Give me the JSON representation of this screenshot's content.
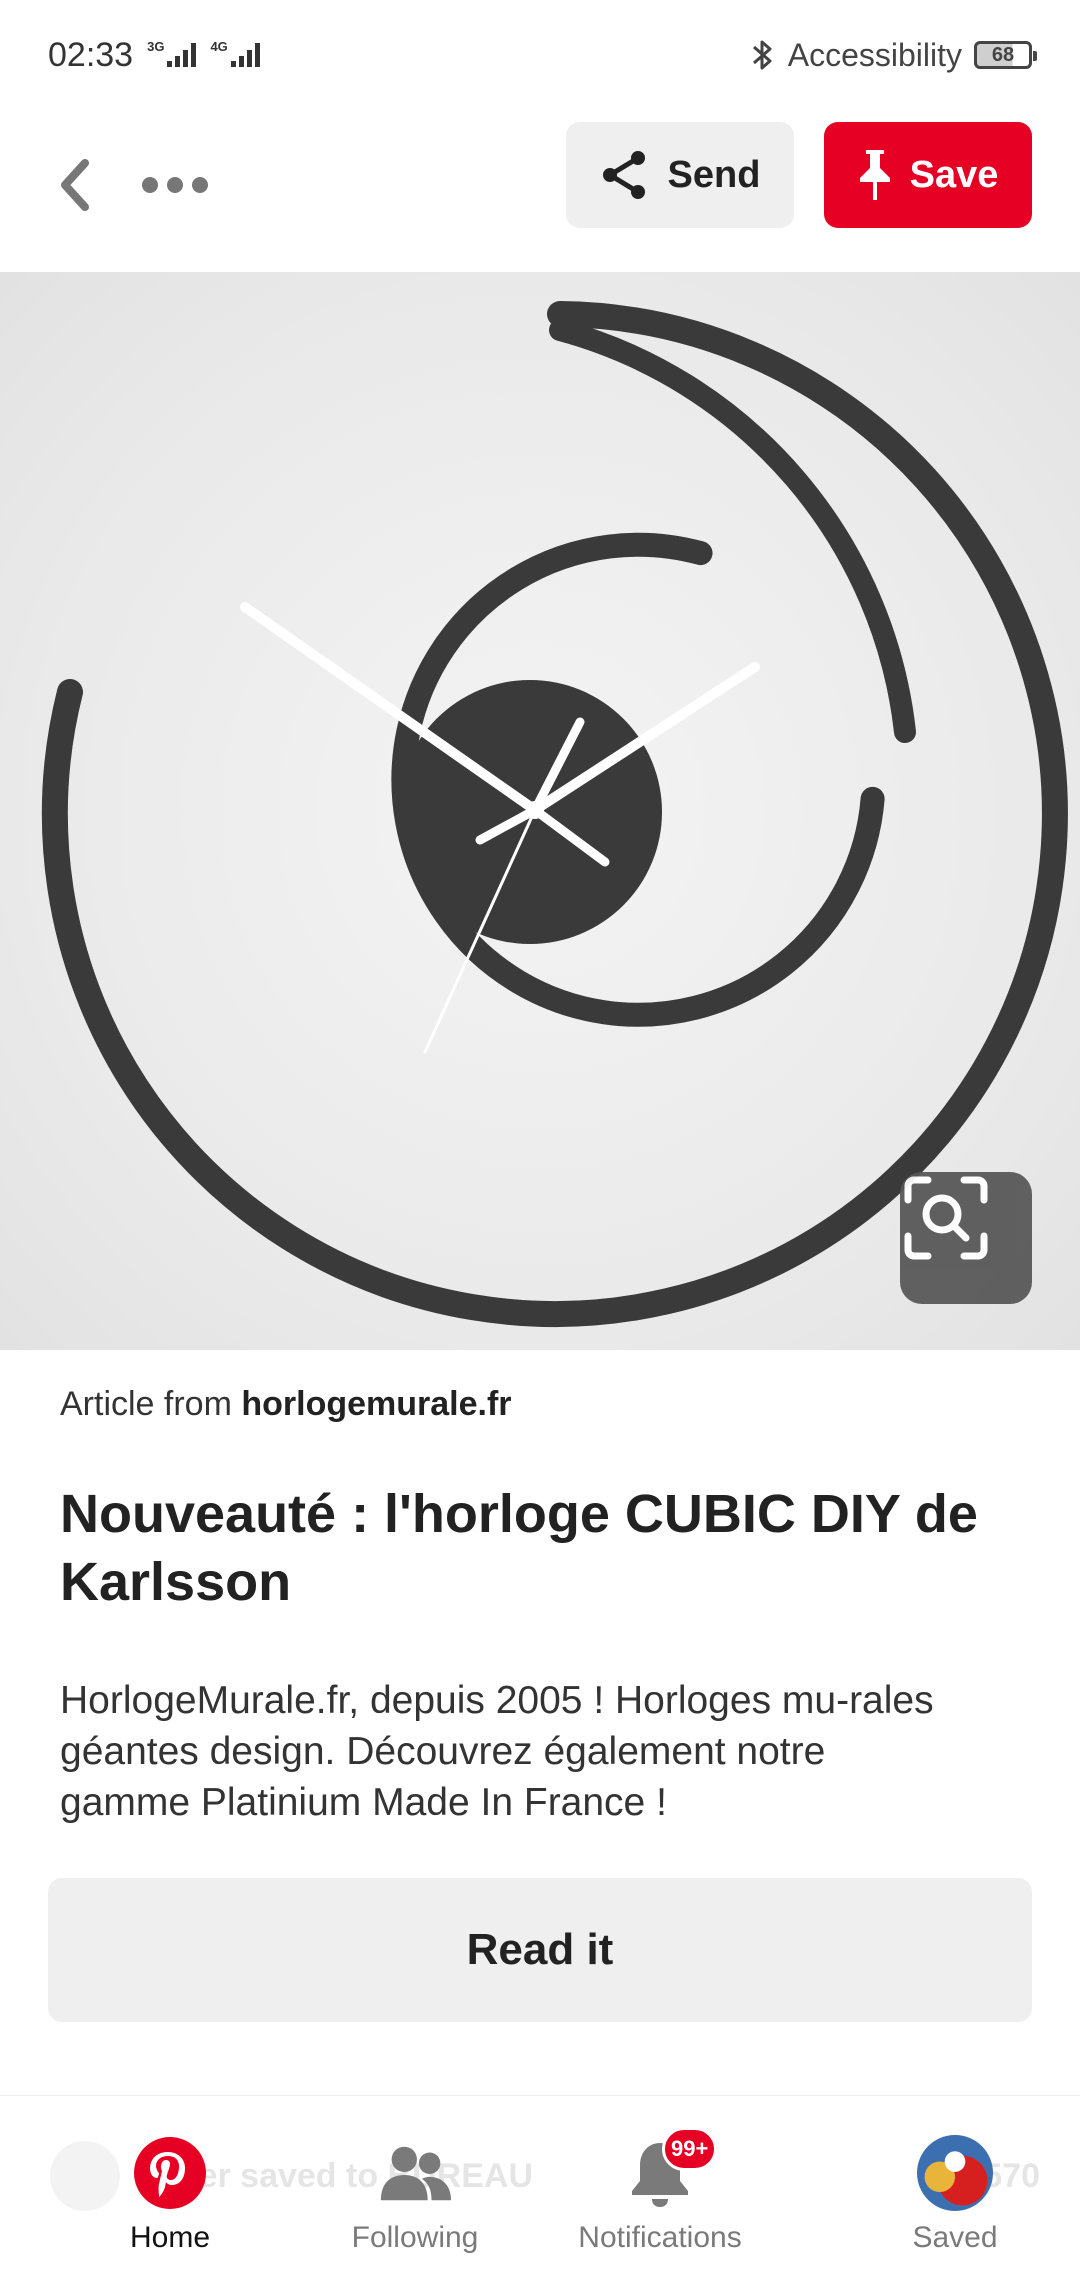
{
  "status_bar": {
    "time": "02:33",
    "net1": "3G",
    "net2": "4G",
    "accessibility": "Accessibility",
    "battery": "68"
  },
  "topbar": {
    "send_label": "Send",
    "save_label": "Save",
    "save_color": "#e60023"
  },
  "pin": {
    "source_prefix": "Article from",
    "source_domain": "horlogemurale.fr",
    "title": "Nouveauté : l'horloge CUBIC DIY de Karlsson",
    "description": "HorlogeMurale.fr, depuis 2005 ! Horloges mu-rales géantes design. Découvrez également notre gamme Platinium Made In France !",
    "read_button": "Read it"
  },
  "peek": {
    "text": "nivier saved to BUREAU",
    "count": "570"
  },
  "bottom_nav": {
    "items": [
      {
        "label": "Home",
        "icon": "pinterest-logo-icon",
        "active": true
      },
      {
        "label": "Following",
        "icon": "people-icon",
        "active": false
      },
      {
        "label": "Notifications",
        "icon": "bell-icon",
        "active": false,
        "badge": "99+"
      },
      {
        "label": "Saved",
        "icon": "avatar",
        "active": false
      }
    ]
  }
}
